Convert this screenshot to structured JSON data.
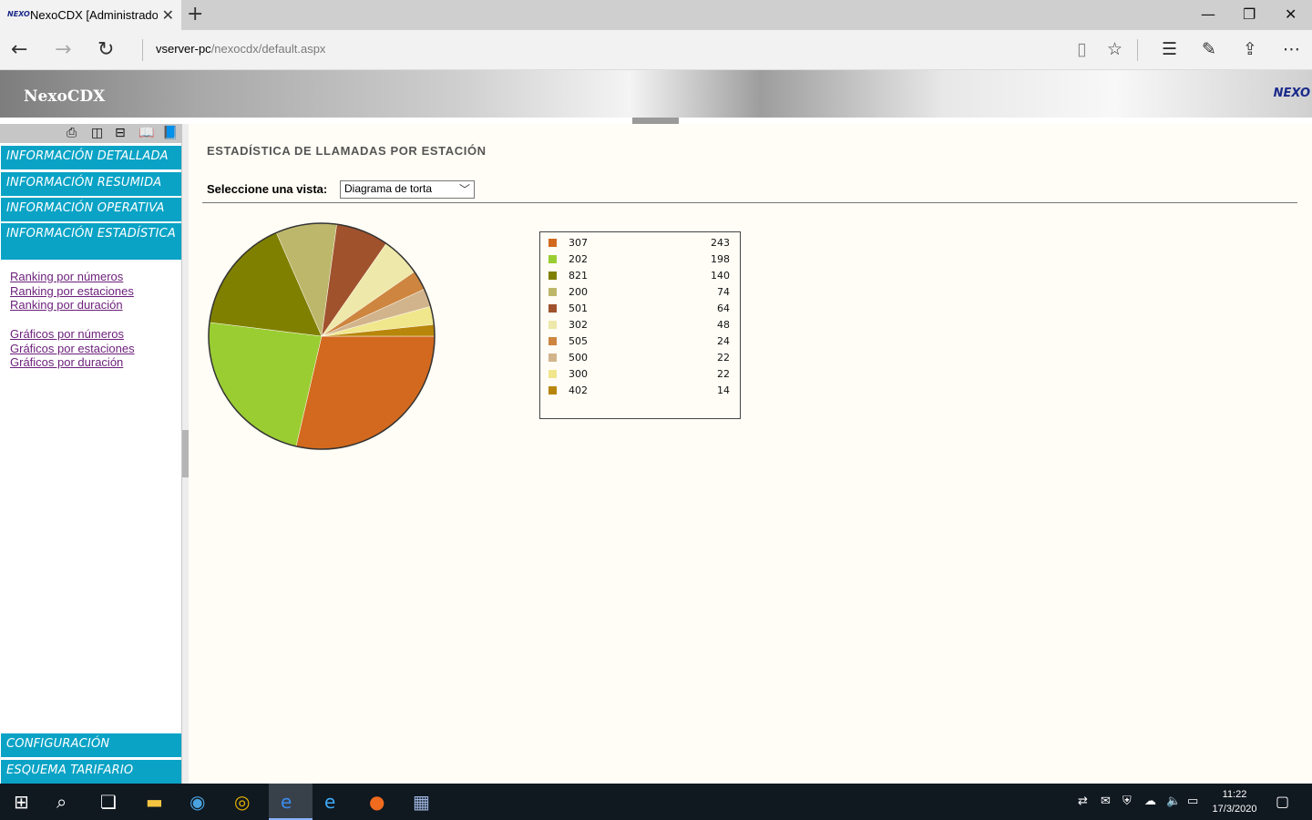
{
  "browser": {
    "tab_title": "NexoCDX [Administrador]",
    "url_host": "vserver-pc",
    "url_path": "/nexocdx/default.aspx"
  },
  "app": {
    "brand": "NexoCDX",
    "logo_text": "NEXO"
  },
  "menu": {
    "items": [
      {
        "label": "INFORMACIÓN DETALLADA"
      },
      {
        "label": "INFORMACIÓN RESUMIDA"
      },
      {
        "label": "INFORMACIÓN OPERATIVA"
      },
      {
        "label": "INFORMACIÓN ESTADÍSTICA"
      },
      {
        "label": "CONFIGURACIÓN"
      },
      {
        "label": "ESQUEMA TARIFARIO"
      }
    ],
    "links_group1": [
      "Ranking por números",
      "Ranking por estaciones",
      "Ranking por duración"
    ],
    "links_group2": [
      "Gráficos por números",
      "Gráficos por estaciones",
      "Gráficos por duración"
    ]
  },
  "content": {
    "title": "ESTADÍSTICA DE LLAMADAS POR ESTACIÓN",
    "view_label": "Seleccione una vista:",
    "view_selected": "Diagrama de torta"
  },
  "chart_data": {
    "type": "pie",
    "title": "",
    "slices": [
      {
        "label": "307",
        "value": 243,
        "color": "#d2691e"
      },
      {
        "label": "202",
        "value": 198,
        "color": "#9acd32"
      },
      {
        "label": "821",
        "value": 140,
        "color": "#808000"
      },
      {
        "label": "200",
        "value": 74,
        "color": "#bdb76b"
      },
      {
        "label": "501",
        "value": 64,
        "color": "#a0522d"
      },
      {
        "label": "302",
        "value": 48,
        "color": "#eee8aa"
      },
      {
        "label": "505",
        "value": 24,
        "color": "#cd853f"
      },
      {
        "label": "500",
        "value": 22,
        "color": "#d2b48c"
      },
      {
        "label": "300",
        "value": 22,
        "color": "#f0e68c"
      },
      {
        "label": "402",
        "value": 14,
        "color": "#b8860b"
      }
    ],
    "legend_position": "right"
  },
  "taskbar": {
    "time": "11:22",
    "date": "17/3/2020"
  }
}
